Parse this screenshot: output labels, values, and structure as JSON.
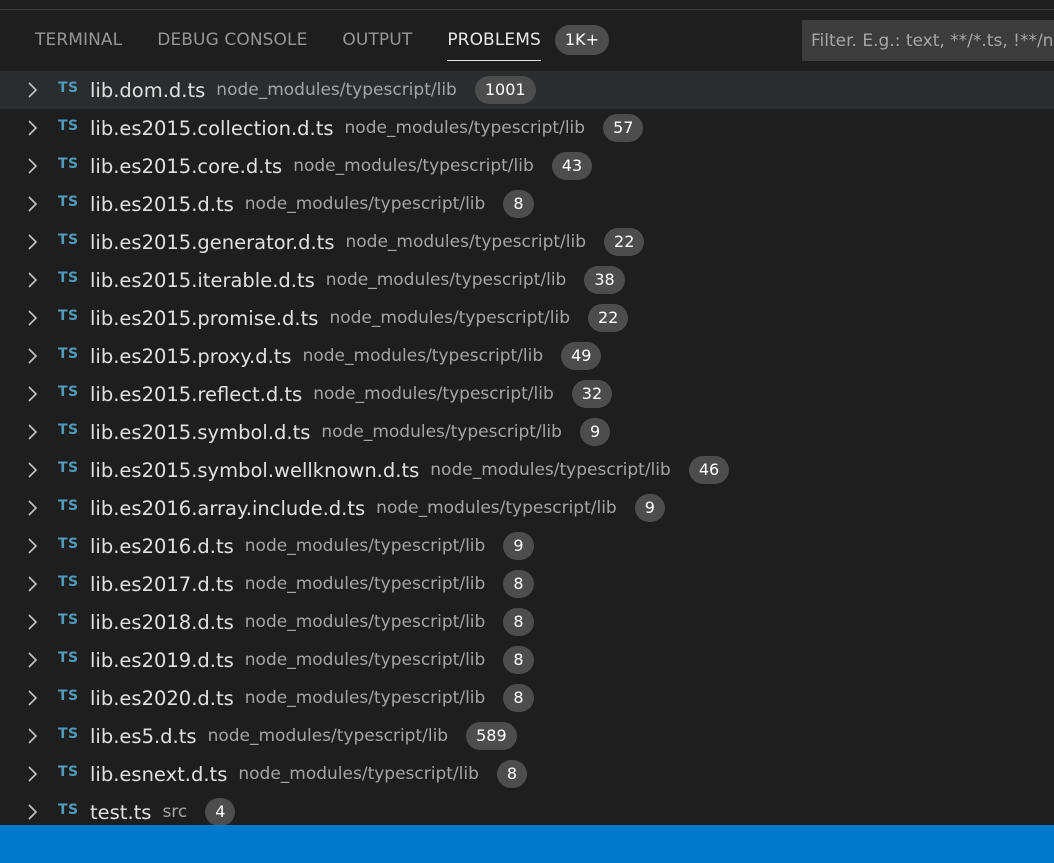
{
  "tabs": [
    {
      "label": "TERMINAL",
      "active": false
    },
    {
      "label": "DEBUG CONSOLE",
      "active": false
    },
    {
      "label": "OUTPUT",
      "active": false
    },
    {
      "label": "PROBLEMS",
      "active": true
    }
  ],
  "problems_badge": "1K+",
  "filter": {
    "placeholder": "Filter. E.g.: text, **/*.ts, !**/node_modules/**",
    "value": ""
  },
  "icons": {
    "chevron": "chevron-right-icon",
    "file": "typescript-file-icon"
  },
  "colors": {
    "background": "#1e1e1e",
    "badge": "#4d4d4d",
    "ts_icon": "#519aba",
    "status_bar": "#007acc"
  },
  "ts_label": "TS",
  "files": [
    {
      "name": "lib.dom.d.ts",
      "path": "node_modules/typescript/lib",
      "count": "1001",
      "selected": true
    },
    {
      "name": "lib.es2015.collection.d.ts",
      "path": "node_modules/typescript/lib",
      "count": "57"
    },
    {
      "name": "lib.es2015.core.d.ts",
      "path": "node_modules/typescript/lib",
      "count": "43"
    },
    {
      "name": "lib.es2015.d.ts",
      "path": "node_modules/typescript/lib",
      "count": "8"
    },
    {
      "name": "lib.es2015.generator.d.ts",
      "path": "node_modules/typescript/lib",
      "count": "22"
    },
    {
      "name": "lib.es2015.iterable.d.ts",
      "path": "node_modules/typescript/lib",
      "count": "38"
    },
    {
      "name": "lib.es2015.promise.d.ts",
      "path": "node_modules/typescript/lib",
      "count": "22"
    },
    {
      "name": "lib.es2015.proxy.d.ts",
      "path": "node_modules/typescript/lib",
      "count": "49"
    },
    {
      "name": "lib.es2015.reflect.d.ts",
      "path": "node_modules/typescript/lib",
      "count": "32"
    },
    {
      "name": "lib.es2015.symbol.d.ts",
      "path": "node_modules/typescript/lib",
      "count": "9"
    },
    {
      "name": "lib.es2015.symbol.wellknown.d.ts",
      "path": "node_modules/typescript/lib",
      "count": "46"
    },
    {
      "name": "lib.es2016.array.include.d.ts",
      "path": "node_modules/typescript/lib",
      "count": "9"
    },
    {
      "name": "lib.es2016.d.ts",
      "path": "node_modules/typescript/lib",
      "count": "9"
    },
    {
      "name": "lib.es2017.d.ts",
      "path": "node_modules/typescript/lib",
      "count": "8"
    },
    {
      "name": "lib.es2018.d.ts",
      "path": "node_modules/typescript/lib",
      "count": "8"
    },
    {
      "name": "lib.es2019.d.ts",
      "path": "node_modules/typescript/lib",
      "count": "8"
    },
    {
      "name": "lib.es2020.d.ts",
      "path": "node_modules/typescript/lib",
      "count": "8"
    },
    {
      "name": "lib.es5.d.ts",
      "path": "node_modules/typescript/lib",
      "count": "589"
    },
    {
      "name": "lib.esnext.d.ts",
      "path": "node_modules/typescript/lib",
      "count": "8"
    },
    {
      "name": "test.ts",
      "path": "src",
      "count": "4"
    }
  ]
}
